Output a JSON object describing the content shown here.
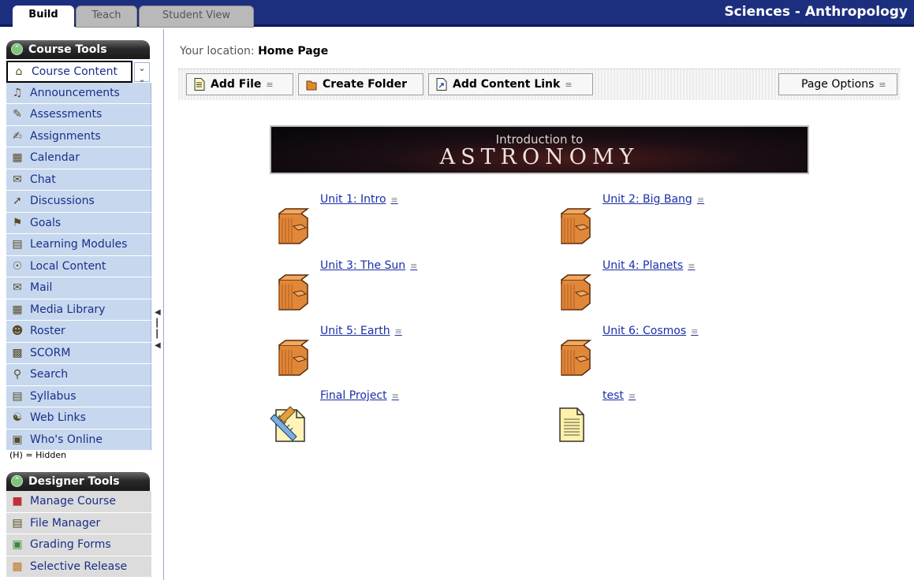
{
  "tabs": [
    {
      "label": "Build"
    },
    {
      "label": "Teach"
    },
    {
      "label": "Student View"
    }
  ],
  "course_title": "Sciences - Anthropology",
  "course_tools": {
    "header": "Course Tools",
    "items": [
      {
        "label": "Course Content",
        "icon": "house-icon"
      },
      {
        "label": "Announcements",
        "icon": "megaphone-icon"
      },
      {
        "label": "Assessments",
        "icon": "assessment-icon"
      },
      {
        "label": "Assignments",
        "icon": "assignment-icon"
      },
      {
        "label": "Calendar",
        "icon": "calendar-icon"
      },
      {
        "label": "Chat",
        "icon": "chat-bubble-icon"
      },
      {
        "label": "Discussions",
        "icon": "pushpin-icon"
      },
      {
        "label": "Goals",
        "icon": "goals-icon"
      },
      {
        "label": "Learning Modules",
        "icon": "module-icon"
      },
      {
        "label": "Local Content",
        "icon": "disc-icon"
      },
      {
        "label": "Mail",
        "icon": "envelope-icon"
      },
      {
        "label": "Media Library",
        "icon": "media-library-icon"
      },
      {
        "label": "Roster",
        "icon": "people-icon"
      },
      {
        "label": "SCORM",
        "icon": "scorm-icon"
      },
      {
        "label": "Search",
        "icon": "magnifier-icon"
      },
      {
        "label": "Syllabus",
        "icon": "syllabus-icon"
      },
      {
        "label": "Web Links",
        "icon": "globe-icon"
      },
      {
        "label": "Who's Online",
        "icon": "person-icon"
      }
    ],
    "hidden_note": "(H) = Hidden"
  },
  "designer_tools": {
    "header": "Designer Tools",
    "items": [
      {
        "label": "Manage Course",
        "icon": "blocks-icon"
      },
      {
        "label": "File Manager",
        "icon": "file-manager-icon"
      },
      {
        "label": "Grading Forms",
        "icon": "grading-icon"
      },
      {
        "label": "Selective Release",
        "icon": "release-icon"
      }
    ]
  },
  "location": {
    "prefix": "Your location:",
    "page": "Home Page"
  },
  "toolbar": {
    "add_file": "Add File",
    "create_folder": "Create Folder",
    "add_content_link": "Add Content Link",
    "page_options": "Page Options"
  },
  "banner": {
    "line1": "Introduction to",
    "line2": "ASTRONOMY"
  },
  "content_items": [
    {
      "label": "Unit 1: Intro",
      "icon": "folder-icon"
    },
    {
      "label": "Unit 2: Big Bang",
      "icon": "folder-icon"
    },
    {
      "label": "Unit 3: The Sun",
      "icon": "folder-icon"
    },
    {
      "label": "Unit 4: Planets",
      "icon": "folder-icon"
    },
    {
      "label": "Unit 5: Earth",
      "icon": "folder-icon"
    },
    {
      "label": "Unit 6: Cosmos",
      "icon": "folder-icon"
    },
    {
      "label": "Final Project",
      "icon": "project-icon"
    },
    {
      "label": "test",
      "icon": "document-icon"
    }
  ],
  "colors": {
    "topbar": "#1c2e7e",
    "sidebar_item": "#c7d8ee",
    "link": "#1a2ea8"
  }
}
